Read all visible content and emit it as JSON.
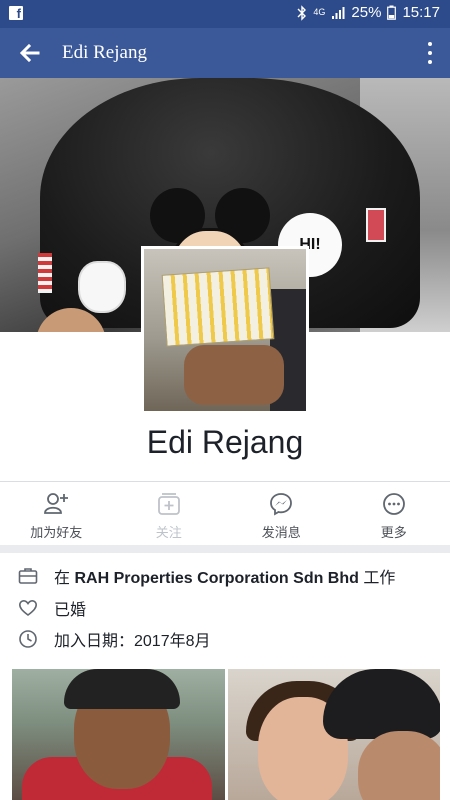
{
  "status_bar": {
    "signal": "4G",
    "battery": "25%",
    "time": "15:17"
  },
  "app_bar": {
    "title": "Edi Rejang"
  },
  "cover": {
    "bubble_text": "HI!"
  },
  "profile": {
    "name": "Edi Rejang"
  },
  "actions": [
    {
      "label": "加为好友",
      "icon": "add-friend-icon",
      "enabled": true
    },
    {
      "label": "关注",
      "icon": "follow-icon",
      "enabled": false
    },
    {
      "label": "发消息",
      "icon": "messenger-icon",
      "enabled": true
    },
    {
      "label": "更多",
      "icon": "more-icon",
      "enabled": true
    }
  ],
  "info": {
    "work_prefix": "在 ",
    "work_company": "RAH Properties Corporation Sdn Bhd",
    "work_suffix": " 工作",
    "relationship": "已婚",
    "joined": "加入日期：2017年8月"
  },
  "colors": {
    "status_bar": "#2d4b8a",
    "app_bar": "#3b5998",
    "icon_gray": "#606770",
    "disabled_gray": "#bec3c9",
    "divider": "#dadde1"
  }
}
